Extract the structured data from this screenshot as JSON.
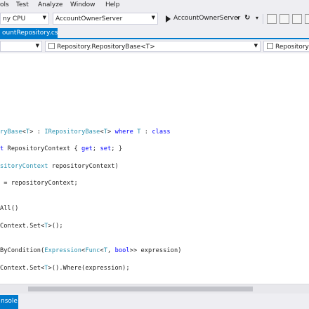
{
  "menu": [
    "ols",
    "Test",
    "Analyze",
    "Window",
    "Help"
  ],
  "toolbar": {
    "platform": "ny CPU",
    "startup_project": "AccountOwnerServer",
    "run_target": "AccountOwnerServer",
    "run_dropdown": "▾",
    "refresh_glyph": "↻",
    "extra_dropdown": "▾"
  },
  "tabs": {
    "active": "ountRepository.cs"
  },
  "navbar": {
    "project": "",
    "type": "Repository.RepositoryBase<T>",
    "member": "RepositoryC"
  },
  "code_lines": [
    [
      {
        "c": "t-type",
        "t": "ryBase"
      },
      {
        "c": "t-plain",
        "t": "<"
      },
      {
        "c": "t-type",
        "t": "T"
      },
      {
        "c": "t-plain",
        "t": "> : "
      },
      {
        "c": "t-type",
        "t": "IRepositoryBase"
      },
      {
        "c": "t-plain",
        "t": "<"
      },
      {
        "c": "t-type",
        "t": "T"
      },
      {
        "c": "t-plain",
        "t": "> "
      },
      {
        "c": "t-kw",
        "t": "where"
      },
      {
        "c": "t-plain",
        "t": " "
      },
      {
        "c": "t-type",
        "t": "T"
      },
      {
        "c": "t-plain",
        "t": " : "
      },
      {
        "c": "t-kw",
        "t": "class"
      }
    ],
    [
      {
        "c": "t-kw",
        "t": "t"
      },
      {
        "c": "t-plain",
        "t": " RepositoryContext { "
      },
      {
        "c": "t-kw",
        "t": "get"
      },
      {
        "c": "t-plain",
        "t": "; "
      },
      {
        "c": "t-kw",
        "t": "set"
      },
      {
        "c": "t-plain",
        "t": "; }"
      }
    ],
    [
      {
        "c": "t-type",
        "t": "sitoryContext"
      },
      {
        "c": "t-plain",
        "t": " repositoryContext)"
      }
    ],
    [
      {
        "c": "t-plain",
        "t": " = repositoryContext;"
      }
    ],
    [
      {
        "c": "t-plain",
        "t": "All()"
      }
    ],
    [
      {
        "c": "t-plain",
        "t": "Context.Set<"
      },
      {
        "c": "t-type",
        "t": "T"
      },
      {
        "c": "t-plain",
        "t": ">();"
      }
    ],
    [
      {
        "c": "t-plain",
        "t": "ByCondition("
      },
      {
        "c": "t-type",
        "t": "Expression"
      },
      {
        "c": "t-plain",
        "t": "<"
      },
      {
        "c": "t-type",
        "t": "Func"
      },
      {
        "c": "t-plain",
        "t": "<"
      },
      {
        "c": "t-type",
        "t": "T"
      },
      {
        "c": "t-plain",
        "t": ", "
      },
      {
        "c": "t-kw",
        "t": "bool"
      },
      {
        "c": "t-plain",
        "t": ">> expression)"
      }
    ],
    [
      {
        "c": "t-plain",
        "t": "Context.Set<"
      },
      {
        "c": "t-type",
        "t": "T"
      },
      {
        "c": "t-plain",
        "t": ">().Where(expression);"
      }
    ]
  ],
  "bottom_panel": {
    "tab": "nsole"
  },
  "colors": {
    "accent": "#007acc",
    "type": "#2b91af",
    "keyword": "#0000ff"
  }
}
